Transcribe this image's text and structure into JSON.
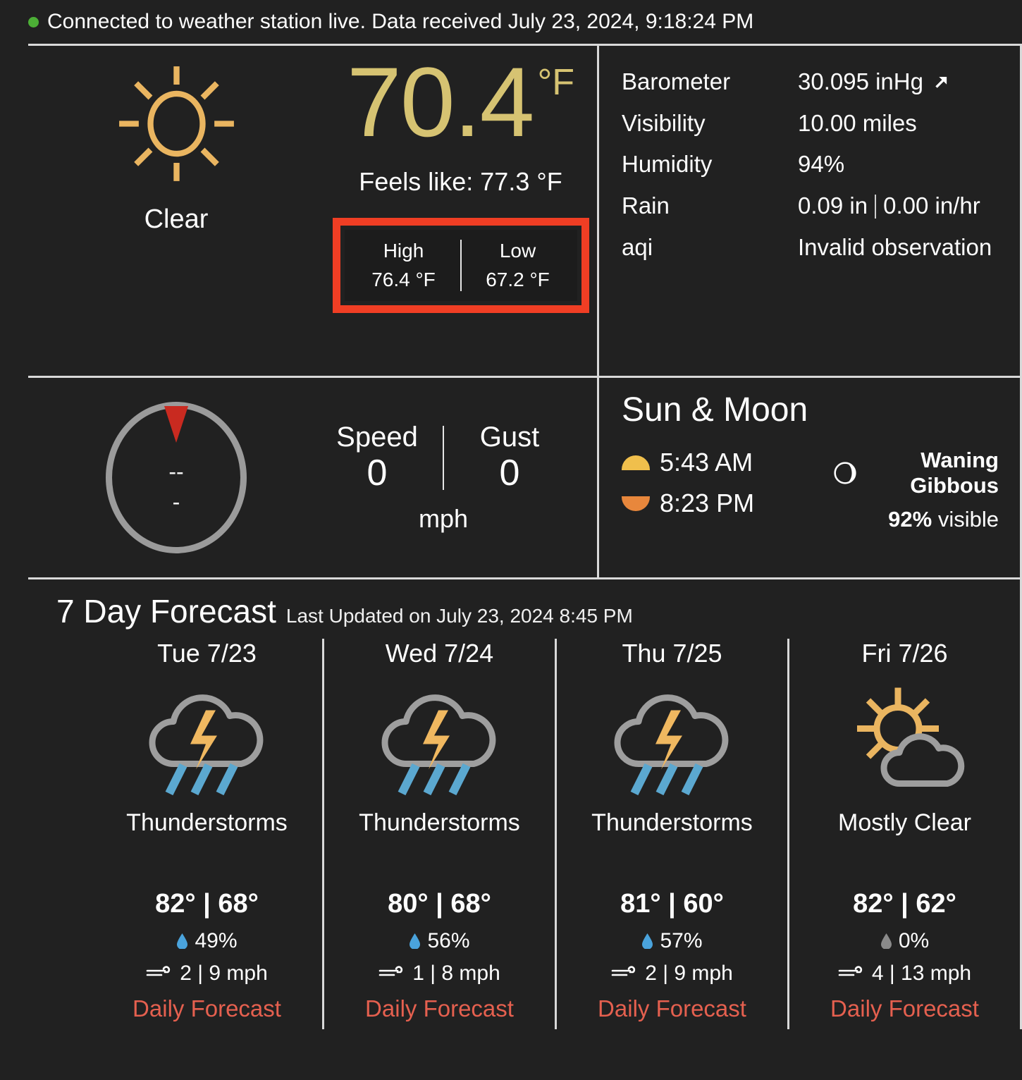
{
  "status": {
    "indicator": "status-dot-connected",
    "text": "Connected to weather station live. Data received July 23, 2024, 9:18:24 PM",
    "dot_color": "#4caf36"
  },
  "current": {
    "condition_icon": "sun-icon",
    "condition": "Clear",
    "temperature": "70.4",
    "temperature_unit": "°F",
    "feels_like": "Feels like: 77.3 °F",
    "high_label": "High",
    "high_value": "76.4 °F",
    "low_label": "Low",
    "low_value": "67.2 °F",
    "highlight_color": "#f03e24",
    "temp_color": "#d6c372"
  },
  "metrics": [
    {
      "label": "Barometer",
      "value": "30.095 inHg",
      "trend_icon": "arrow-up-right-icon"
    },
    {
      "label": "Visibility",
      "value": "10.00 miles",
      "trend_icon": ""
    },
    {
      "label": "Humidity",
      "value": "94%",
      "trend_icon": ""
    },
    {
      "label": "Rain",
      "value": "0.09 in",
      "value2": "0.00 in/hr",
      "trend_icon": ""
    },
    {
      "label": "aqi",
      "value": "Invalid observation",
      "trend_icon": ""
    }
  ],
  "wind": {
    "compass_icon": "wind-direction-compass",
    "direction_primary": "--",
    "direction_secondary": "-",
    "speed_label": "Speed",
    "speed_value": "0",
    "gust_label": "Gust",
    "gust_value": "0",
    "unit": "mph"
  },
  "sun_moon": {
    "title": "Sun & Moon",
    "sunrise_icon": "sunrise-icon",
    "sunrise": "5:43 AM",
    "sunset_icon": "sunset-icon",
    "sunset": "8:23 PM",
    "moon_icon": "waning-gibbous-moon-icon",
    "moon_phase": "Waning Gibbous",
    "moon_visible_pct": "92%",
    "moon_visible_suffix": "visible"
  },
  "forecast": {
    "title": "7 Day Forecast",
    "last_updated": "Last Updated on July 23, 2024 8:45 PM",
    "link_label": "Daily Forecast",
    "days": [
      {
        "day": "Tue 7/23",
        "icon": "thunderstorm-icon",
        "condition": "Thunderstorms",
        "high": "82°",
        "low": "68°",
        "precip": "49%",
        "precip_color": "#4aa3dc",
        "wind": "2 | 9 mph"
      },
      {
        "day": "Wed 7/24",
        "icon": "thunderstorm-icon",
        "condition": "Thunderstorms",
        "high": "80°",
        "low": "68°",
        "precip": "56%",
        "precip_color": "#4aa3dc",
        "wind": "1 | 8 mph"
      },
      {
        "day": "Thu 7/25",
        "icon": "thunderstorm-icon",
        "condition": "Thunderstorms",
        "high": "81°",
        "low": "60°",
        "precip": "57%",
        "precip_color": "#4aa3dc",
        "wind": "2 | 9 mph"
      },
      {
        "day": "Fri 7/26",
        "icon": "sun-behind-cloud-icon",
        "condition": "Mostly Clear",
        "high": "82°",
        "low": "62°",
        "precip": "0%",
        "precip_color": "#8a8a8a",
        "wind": "4 | 13 mph"
      }
    ]
  }
}
